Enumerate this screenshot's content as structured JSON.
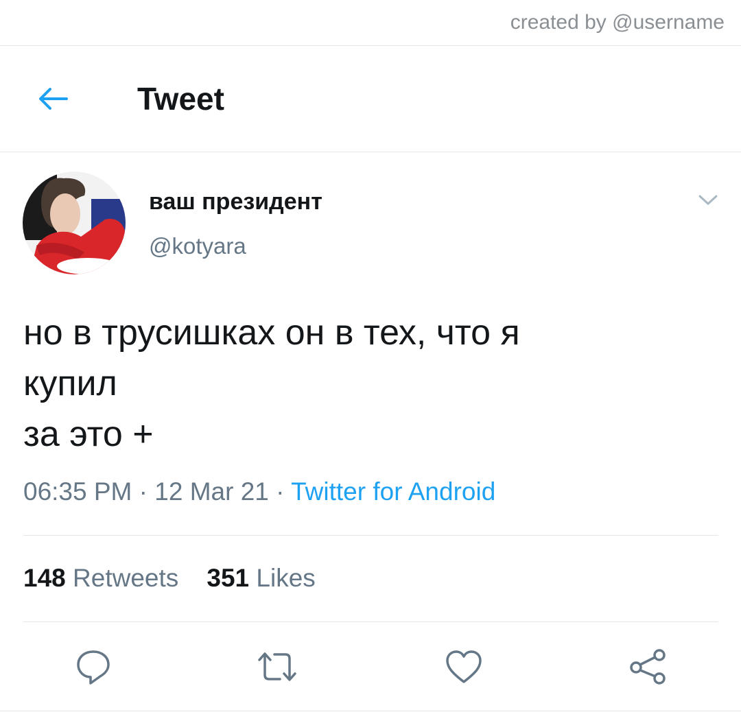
{
  "credit": "created by @username",
  "header": {
    "title": "Tweet",
    "back_icon": "arrow-left-icon"
  },
  "tweet": {
    "display_name": "ваш президент",
    "handle": "@kotyara",
    "text_lines": [
      "но в трусишках он в тех, что я",
      "купил",
      "за это +"
    ],
    "time": "06:35 PM",
    "date": "12 Mar 21",
    "separator": "·",
    "source": "Twitter for Android",
    "retweets_count": "148",
    "retweets_label": "Retweets",
    "likes_count": "351",
    "likes_label": "Likes"
  },
  "actions": [
    "reply-icon",
    "retweet-icon",
    "like-icon",
    "share-icon"
  ],
  "colors": {
    "accent": "#1da1f2",
    "text": "#14171a",
    "muted": "#657786",
    "divider": "#e1e8ed"
  }
}
